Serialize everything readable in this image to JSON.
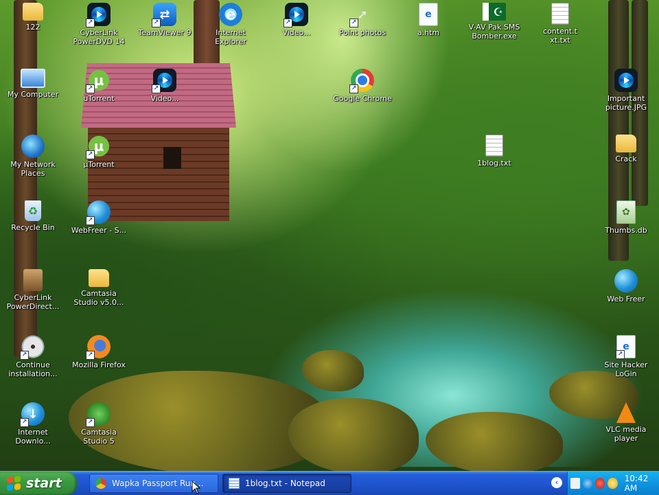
{
  "desktop": {
    "icons": [
      {
        "name": "folder-122",
        "label": "122",
        "icon": "folder-icon",
        "shortcut": false
      },
      {
        "name": "cyberlink-powerdvd",
        "label": "CyberLink\nPowerDVD 14",
        "icon": "media-player-icon",
        "shortcut": true
      },
      {
        "name": "teamviewer",
        "label": "TeamViewer 9",
        "icon": "teamviewer-icon",
        "shortcut": true
      },
      {
        "name": "internet-explorer",
        "label": "Internet\nExplorer",
        "icon": "internet-explorer-icon",
        "shortcut": false
      },
      {
        "name": "media-shortcut-top",
        "label": "Video...",
        "icon": "media-player-icon",
        "shortcut": true
      },
      {
        "name": "pointer-shortcut",
        "label": "Point photos",
        "icon": "cursor-icon",
        "shortcut": true
      },
      {
        "name": "htm-file",
        "label": "a.htm",
        "icon": "html-file-icon",
        "shortcut": false
      },
      {
        "name": "pak-sms-bomber",
        "label": "V-AV Pak SMS\nBomber.exe",
        "icon": "pakistan-flag-icon",
        "shortcut": false
      },
      {
        "name": "content-file",
        "label": "content.t\nxt.txt",
        "icon": "text-file-icon",
        "shortcut": false
      },
      {
        "name": "my-computer",
        "label": "My Computer",
        "icon": "computer-icon",
        "shortcut": false
      },
      {
        "name": "utorrent-shortcut",
        "label": "uTorrent",
        "icon": "utorrent-icon",
        "shortcut": true
      },
      {
        "name": "media-shortcut-2",
        "label": "Video...",
        "icon": "media-player-icon",
        "shortcut": true
      },
      {
        "name": "google-chrome",
        "label": "Google Chrome",
        "icon": "chrome-icon",
        "shortcut": true
      },
      {
        "name": "important-picture",
        "label": "Important\npicture.JPG",
        "icon": "media-player-icon",
        "shortcut": false
      },
      {
        "name": "my-network-places",
        "label": "My Network\nPlaces",
        "icon": "network-icon",
        "shortcut": false
      },
      {
        "name": "utorrent",
        "label": "µTorrent",
        "icon": "utorrent-icon",
        "shortcut": true
      },
      {
        "name": "1blog-txt",
        "label": "1blog.txt",
        "icon": "text-file-icon",
        "shortcut": false
      },
      {
        "name": "crack-folder",
        "label": "Crack",
        "icon": "folder-icon",
        "shortcut": false
      },
      {
        "name": "recycle-bin",
        "label": "Recycle Bin",
        "icon": "recycle-bin-icon",
        "shortcut": false
      },
      {
        "name": "webfreer",
        "label": "WebFreer - S...",
        "icon": "globe-icon",
        "shortcut": true
      },
      {
        "name": "thumbs-db",
        "label": "Thumbs.db",
        "icon": "database-file-icon",
        "shortcut": false
      },
      {
        "name": "cyberlink-powerdirector",
        "label": "CyberLink\nPowerDirect...",
        "icon": "software-box-icon",
        "shortcut": false
      },
      {
        "name": "camtasia-studio-folder",
        "label": "Camtasia\nStudio v5.0...",
        "icon": "folder-icon",
        "shortcut": false
      },
      {
        "name": "web-freer",
        "label": "Web Freer",
        "icon": "globe-icon",
        "shortcut": false
      },
      {
        "name": "continue-installation",
        "label": "Continue\ninstallation...",
        "icon": "cd-install-icon",
        "shortcut": true
      },
      {
        "name": "mozilla-firefox",
        "label": "Mozilla Firefox",
        "icon": "firefox-icon",
        "shortcut": true
      },
      {
        "name": "site-hacker-login",
        "label": "Site Hacker\nLoGin",
        "icon": "html-file-icon",
        "shortcut": true
      },
      {
        "name": "internet-download-manager",
        "label": "Internet\nDownlo...",
        "icon": "download-manager-icon",
        "shortcut": true
      },
      {
        "name": "camtasia-studio",
        "label": "Camtasia\nStudio 5",
        "icon": "camtasia-icon",
        "shortcut": true
      },
      {
        "name": "vlc-media-player",
        "label": "VLC media\nplayer",
        "icon": "vlc-icon",
        "shortcut": false
      }
    ]
  },
  "taskbar": {
    "start_label": "start",
    "tasks": [
      {
        "label": "Wapka Passport Run...",
        "icon": "chrome-icon",
        "active": false
      },
      {
        "label": "1blog.txt - Notepad",
        "icon": "notepad-icon",
        "active": true
      }
    ],
    "clock": "10:42 AM",
    "tray_icons": [
      "volume-icon",
      "network-status-icon",
      "antivirus-icon",
      "chat-icon"
    ],
    "colors": {
      "taskbar": "#245edb",
      "start": "#3c9a41",
      "tray": "#0f94e0"
    }
  }
}
